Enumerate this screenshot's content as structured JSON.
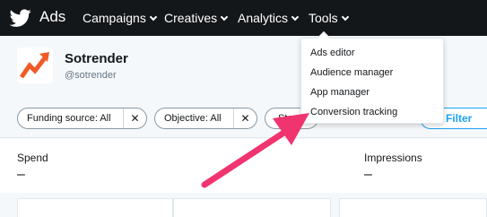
{
  "topbar": {
    "brand": "Ads",
    "nav": [
      {
        "label": "Campaigns"
      },
      {
        "label": "Creatives"
      },
      {
        "label": "Analytics"
      },
      {
        "label": "Tools"
      }
    ]
  },
  "account": {
    "name": "Sotrender",
    "handle": "@sotrender"
  },
  "filters": {
    "chips": [
      {
        "label": "Funding source: All"
      },
      {
        "label": "Objective: All"
      },
      {
        "label": "Sta"
      }
    ],
    "remove_glyph": "✕",
    "filter_button": "Filter"
  },
  "metrics": [
    {
      "label": "Spend",
      "value": "–"
    },
    {
      "label": "Impressions",
      "value": "–"
    }
  ],
  "tools_menu": {
    "items": [
      {
        "label": "Ads editor"
      },
      {
        "label": "Audience manager"
      },
      {
        "label": "App manager"
      },
      {
        "label": "Conversion tracking"
      }
    ]
  },
  "colors": {
    "topbar": "#14171a",
    "accent": "#1da1f2",
    "annotation_arrow": "#f0346f",
    "logo": "#f05a28"
  }
}
